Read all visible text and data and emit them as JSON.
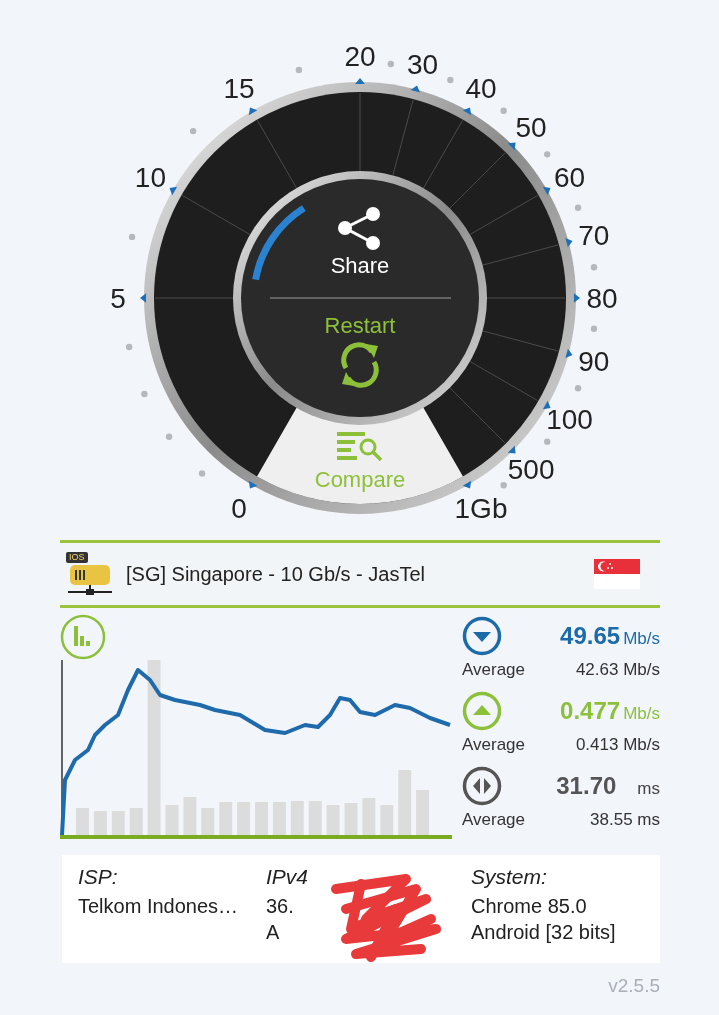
{
  "gauge": {
    "scale_labels": [
      "0",
      "5",
      "10",
      "15",
      "20",
      "30",
      "40",
      "50",
      "60",
      "70",
      "80",
      "90",
      "100",
      "500",
      "1Gb"
    ],
    "share_label": "Share",
    "restart_label": "Restart",
    "compare_label": "Compare"
  },
  "server": {
    "badge": "IOS",
    "name": "[SG] Singapore - 10 Gb/s - JasTel"
  },
  "results": [
    {
      "kind": "download",
      "value": "49.65",
      "unit": "Mb/s",
      "average_label": "Average",
      "average": "42.63 Mb/s"
    },
    {
      "kind": "upload",
      "value": "0.477",
      "unit": "Mb/s",
      "average_label": "Average",
      "average": "0.413 Mb/s"
    },
    {
      "kind": "ping",
      "value": "31.70",
      "unit": "ms",
      "average_label": "Average",
      "average": "38.55 ms"
    }
  ],
  "info": [
    {
      "kind": "isp",
      "label": "ISP:",
      "lines": [
        "Telkom Indones…"
      ]
    },
    {
      "kind": "ipv4",
      "label": "IPv4",
      "lines": [
        "36.",
        "A"
      ]
    },
    {
      "kind": "system",
      "label": "System:",
      "lines": [
        "Chrome 85.0",
        "Android [32 bits]"
      ]
    }
  ],
  "version": "v2.5.5"
}
